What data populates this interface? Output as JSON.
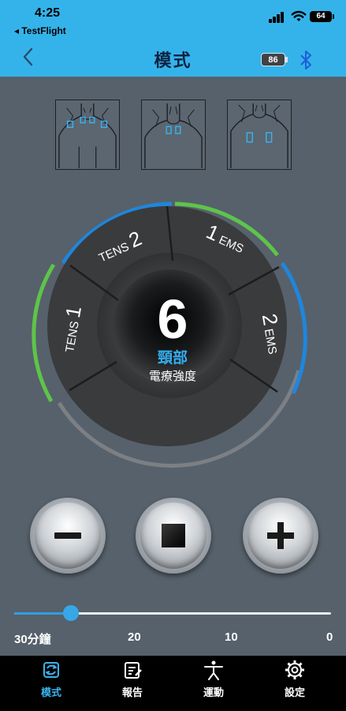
{
  "status_bar": {
    "time": "4:25",
    "back_app": "◂ TestFlight",
    "battery": "64"
  },
  "header": {
    "title": "模式",
    "device_battery": "86"
  },
  "placements": [
    {
      "name": "neck"
    },
    {
      "name": "upper-neck"
    },
    {
      "name": "shoulders"
    }
  ],
  "dial": {
    "intensity": "6",
    "body_part": "頸部",
    "intensity_label": "電療強度",
    "modes": [
      {
        "label": "TENS",
        "num": "1"
      },
      {
        "label": "TENS",
        "num": "2"
      },
      {
        "label": "EMS",
        "num": "1"
      },
      {
        "label": "EMS",
        "num": "2"
      }
    ]
  },
  "controls": {
    "minus": "minus-icon",
    "stop": "stop-icon",
    "plus": "plus-icon"
  },
  "timer": {
    "ticks": [
      "30分鐘",
      "20",
      "10",
      "0"
    ],
    "progress": 0.18
  },
  "tabs": [
    {
      "label": "模式",
      "active": true,
      "icon": "mode-icon"
    },
    {
      "label": "報告",
      "active": false,
      "icon": "report-icon"
    },
    {
      "label": "運動",
      "active": false,
      "icon": "exercise-icon"
    },
    {
      "label": "設定",
      "active": false,
      "icon": "settings-icon"
    }
  ],
  "colors": {
    "accent": "#34b3ea",
    "green": "#5ec44a",
    "blue": "#1f86dc",
    "background": "#56616b"
  }
}
